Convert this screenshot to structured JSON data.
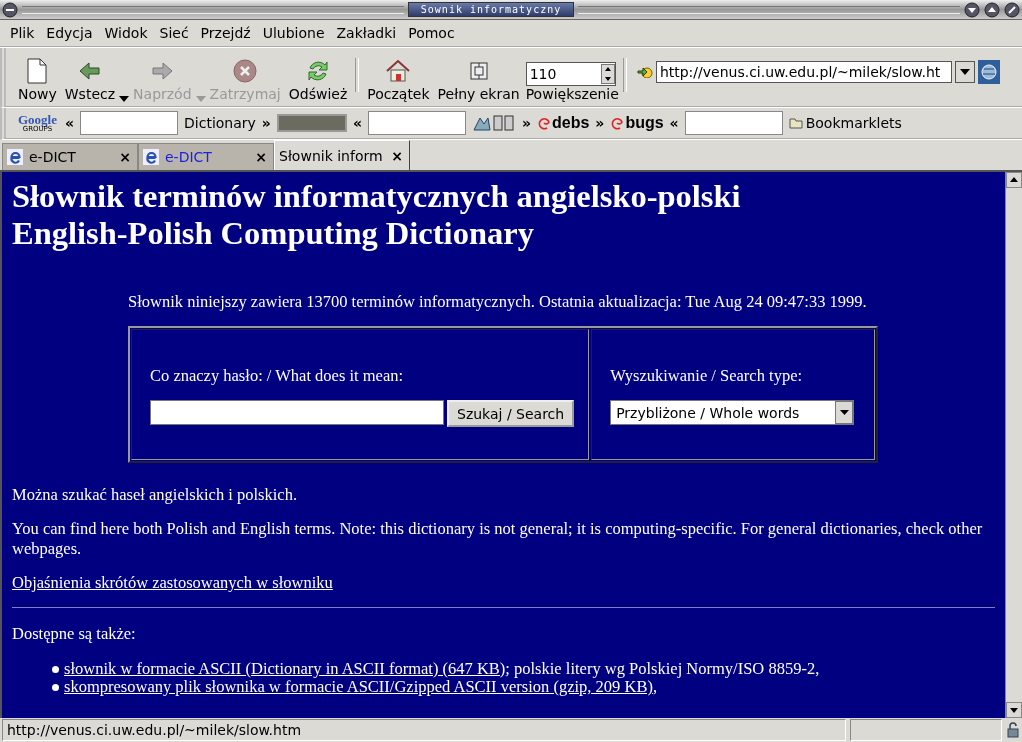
{
  "window": {
    "title": "Sownik informatyczny"
  },
  "menu": [
    "Plik",
    "Edycja",
    "Widok",
    "Sieć",
    "Przejdź",
    "Ulubione",
    "Zakładki",
    "Pomoc"
  ],
  "toolbar": {
    "buttons": [
      {
        "label": "Nowy",
        "disabled": false,
        "dropdown": false
      },
      {
        "label": "Wstecz",
        "disabled": false,
        "dropdown": true
      },
      {
        "label": "Naprzód",
        "disabled": true,
        "dropdown": true
      },
      {
        "label": "Zatrzymaj",
        "disabled": true,
        "dropdown": false
      },
      {
        "label": "Odśwież",
        "disabled": false,
        "dropdown": false
      },
      {
        "label": "Początek",
        "disabled": false,
        "dropdown": false
      },
      {
        "label": "Pełny ekran",
        "disabled": false,
        "dropdown": false
      }
    ],
    "zoom": {
      "value": "110",
      "label": "Powiększenie"
    },
    "address": {
      "value": "http://venus.ci.uw.edu.pl/~milek/slow.ht"
    }
  },
  "bookmarks": [
    {
      "kind": "logo",
      "text": "Google",
      "subtext": "GROUPS"
    },
    {
      "kind": "chevron",
      "text": "«"
    },
    {
      "kind": "field"
    },
    {
      "kind": "link",
      "text": "Dictionary"
    },
    {
      "kind": "chevron",
      "text": "»"
    },
    {
      "kind": "banner"
    },
    {
      "kind": "chevron",
      "text": "«"
    },
    {
      "kind": "field"
    },
    {
      "kind": "emblem"
    },
    {
      "kind": "chevron",
      "text": "»"
    },
    {
      "kind": "swirl",
      "text": "debs"
    },
    {
      "kind": "chevron",
      "text": "»"
    },
    {
      "kind": "swirl",
      "text": "bugs"
    },
    {
      "kind": "chevron",
      "text": "«"
    },
    {
      "kind": "field"
    },
    {
      "kind": "folder",
      "text": "Bookmarklets"
    }
  ],
  "tabs": [
    {
      "label": "e-DICT",
      "close": "×",
      "selected": false,
      "unread": false,
      "has_icon": true
    },
    {
      "label": "e-DICT",
      "close": "×",
      "selected": false,
      "unread": true,
      "has_icon": true
    },
    {
      "label": "Słownik inform",
      "close": "×",
      "selected": true,
      "unread": false,
      "has_icon": false
    }
  ],
  "page": {
    "heading": [
      "Słownik terminów informatycznych angielsko-polski",
      "English-Polish Computing Dictionary"
    ],
    "intro": "Słownik niniejszy zawiera 13700 terminów informatycznych. Ostatnia aktualizacja: Tue Aug 24 09:47:33 1999.",
    "form": {
      "query_label": "Co znaczy hasło: / What does it mean:",
      "button": "Szukaj / Search",
      "type_label": "Wyszukiwanie / Search type:",
      "type_value": "Przybliżone / Whole words"
    },
    "paragraphs": [
      "Można szukać haseł angielskich i polskich.",
      "You can find here both Polish and English terms. Note: this dictionary is not general; it is computing-specific. For general dictionaries, check other webpages."
    ],
    "abbrev_link": "Objaśnienia skrótów zastosowanych w słowniku",
    "also_heading": "Dostępne są także:",
    "also": [
      {
        "link": "słownik w formacie ASCII (Dictionary in ASCII format) (647 KB)",
        "text": "; polskie litery wg Polskiej Normy/ISO 8859-2,"
      },
      {
        "link": "skompresowany plik słownika w formacie ASCII/Gzipped ASCII version (gzip, 209 KB)",
        "text": ","
      }
    ]
  },
  "status_bar": {
    "text": "http://venus.ci.uw.edu.pl/~milek/slow.htm"
  }
}
